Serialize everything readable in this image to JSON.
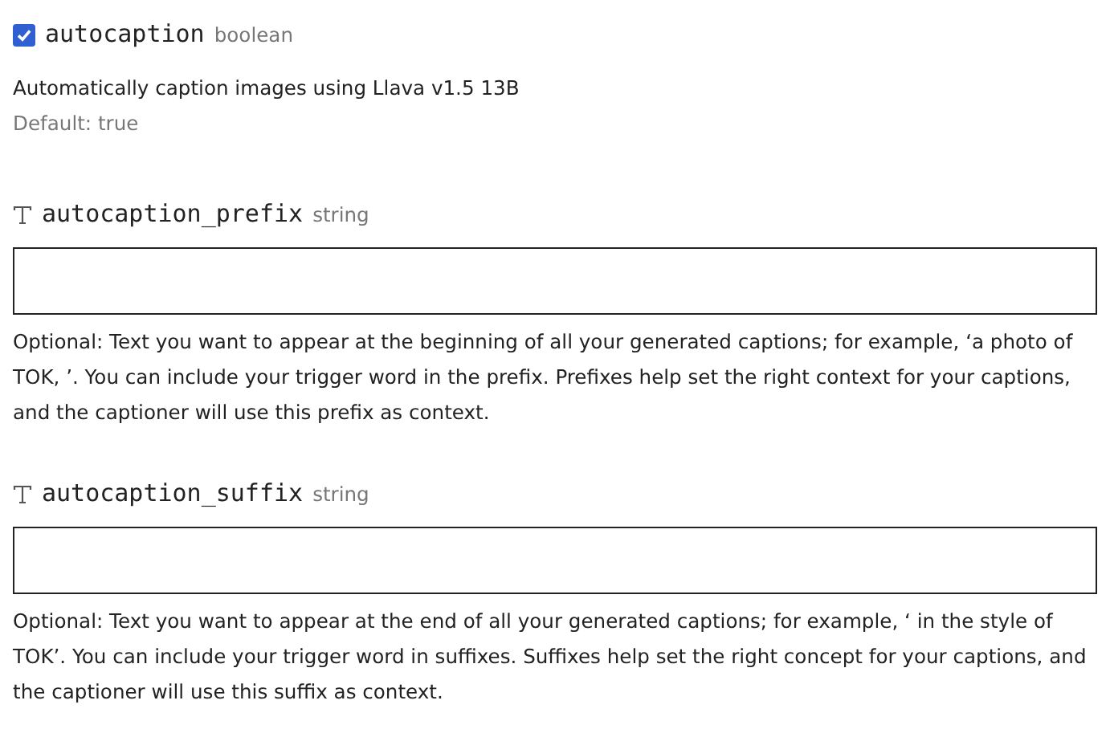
{
  "fields": [
    {
      "kind": "boolean",
      "name": "autocaption",
      "type": "boolean",
      "checked": true,
      "description": "Automatically caption images using Llava v1.5 13B",
      "default": "Default: true"
    },
    {
      "kind": "string",
      "name": "autocaption_prefix",
      "type": "string",
      "description": "Optional: Text you want to appear at the beginning of all your generated captions; for example, ‘a photo of TOK, ’. You can include your trigger word in the prefix. Prefixes help set the right context for your captions, and the captioner will use this prefix as context."
    },
    {
      "kind": "string",
      "name": "autocaption_suffix",
      "type": "string",
      "description": "Optional: Text you want to appear at the end of all your generated captions; for example, ‘ in the style of TOK’. You can include your trigger word in suffixes. Suffixes help set the right concept for your captions, and the captioner will use this suffix as context."
    }
  ]
}
